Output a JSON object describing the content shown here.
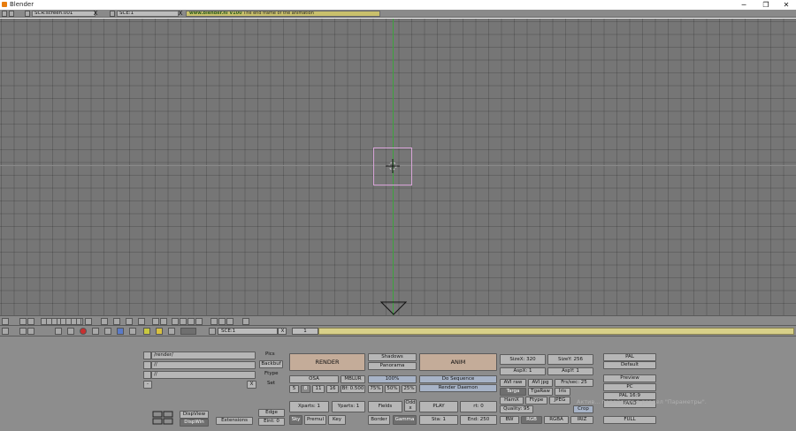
{
  "window": {
    "title": "Blender",
    "minimize": "─",
    "maximize": "❐",
    "close": "✕"
  },
  "top_header": {
    "screen": "SCR:screen.001",
    "scene": "SCE:1",
    "info_url": "www.blender.nl V100",
    "info_text": "The end  frame of the animation",
    "close": "X"
  },
  "buttons_header": {
    "scene": "SCE:1",
    "frame": "1",
    "close": "X"
  },
  "paths": {
    "pics": "/render/",
    "backbuf": "//",
    "ftype": "//",
    "labels": {
      "pics": "Pics",
      "backbuf": "Backbuf",
      "ftype": "Ftype",
      "set": "Set"
    },
    "close": "X",
    "dash": "-"
  },
  "display": {
    "dispview": "DispView",
    "dispwin": "DispWin",
    "extensions": "Extensions",
    "edge": "Edge",
    "eint": "Eint: 0"
  },
  "render": {
    "render": "RENDER",
    "shadows": "Shadows",
    "panorama": "Panorama",
    "osa": "OSA",
    "mblur": "MBLUR",
    "percent_100": "100%",
    "osa_levels": [
      "5",
      "8",
      "11",
      "16"
    ],
    "bf": "Bf: 0.500",
    "percent_75": "75%",
    "percent_50": "50%",
    "percent_25": "25%",
    "xparts": "Xparts: 1",
    "yparts": "Yparts: 1",
    "fields": "Fields",
    "odd": "Odd",
    "x": "x",
    "sky": "Sky",
    "premul": "Premul",
    "key": "Key",
    "border": "Border",
    "gamma": "Gamma"
  },
  "anim": {
    "anim": "ANIM",
    "do_sequence": "Do Sequence",
    "render_daemon": "Render Daemon",
    "play": "PLAY",
    "rt": "rt: 0",
    "sta": "Sta: 1",
    "end": "End: 250"
  },
  "format": {
    "sizex": "SizeX: 320",
    "sizey": "SizeY: 256",
    "aspx": "AspX: 1",
    "aspy": "AspY: 1",
    "avi_raw": "AVI raw",
    "avi_jpg": "AVI jpg",
    "frs_sec": "Frs/sec: 25",
    "targa": "Targa",
    "tgaraw": "TgaRaw",
    "iris": "Iris",
    "hamx": "HamX",
    "ftype": "Ftype",
    "jpeg": "JPEG",
    "quality": "Quality: 95",
    "crop": "Crop",
    "bw": "BW",
    "rgb": "RGB",
    "rgba": "RGBA",
    "iriz": "IRIZ"
  },
  "presets": {
    "pal": "PAL",
    "default": "Default",
    "preview": "Preview",
    "pc": "PC",
    "pal169": "PAL 16:9",
    "pano": "PANO",
    "full": "FULL"
  },
  "watermark": "Актив... перейдите в раздел \"Параметры\".",
  "colors": {
    "viewport_bg": "#767676",
    "grid": "#5e5e5e",
    "axis_y": "#3ca43c",
    "camera_frame": "#d8a4d8",
    "button": "#b6b6b6",
    "button_salmon": "#c4ac99",
    "button_blue": "#a7b3c7",
    "header_strip": "#d8d089"
  }
}
